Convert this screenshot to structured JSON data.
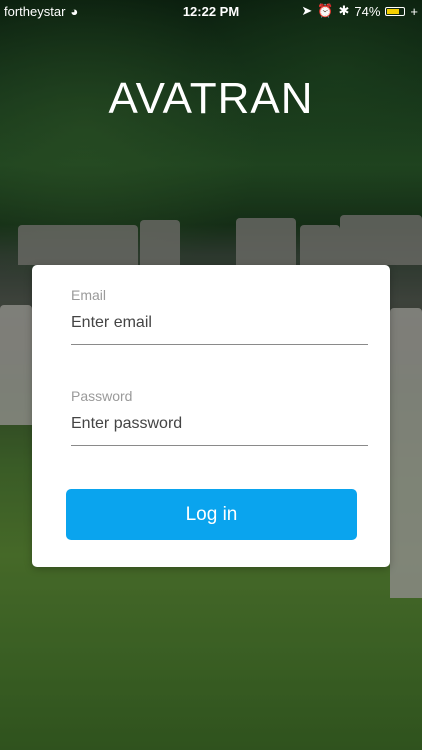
{
  "status_bar": {
    "carrier": "fortheystar",
    "time": "12:22 PM",
    "battery_text": "74%"
  },
  "app": {
    "title": "AVATRAN"
  },
  "login_form": {
    "email_label": "Email",
    "email_placeholder": "Enter email",
    "password_label": "Password",
    "password_placeholder": "Enter password",
    "submit_label": "Log in"
  },
  "colors": {
    "accent": "#0aa4ee",
    "battery": "#f5d000"
  }
}
